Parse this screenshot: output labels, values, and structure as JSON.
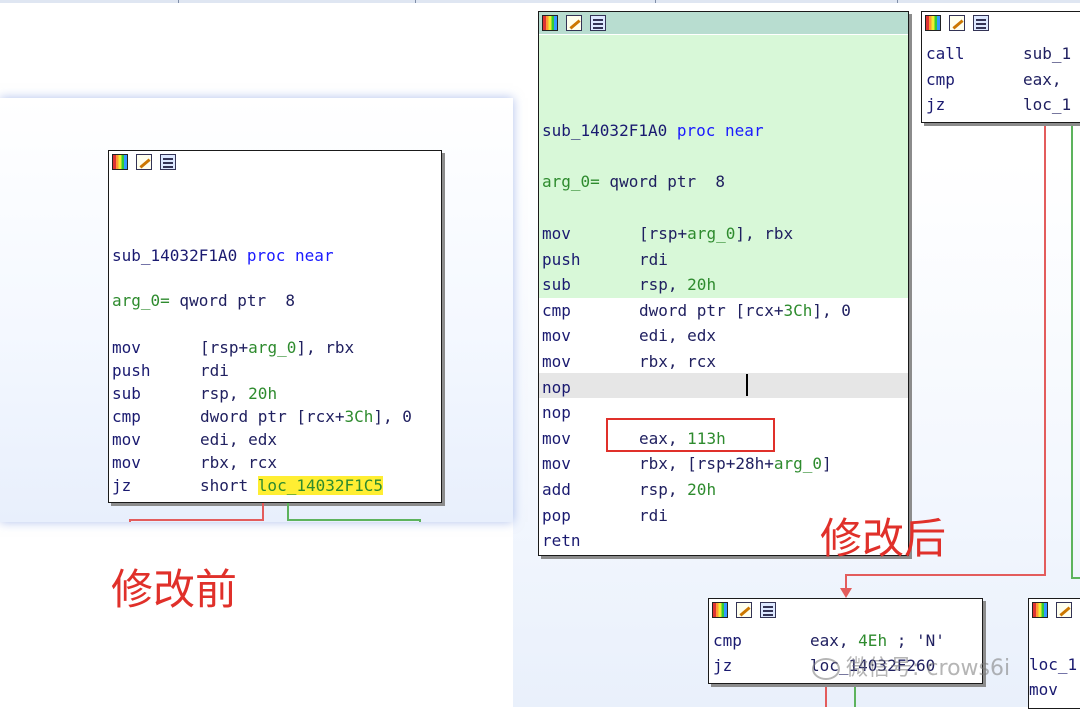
{
  "left_node": {
    "proc": "sub_14032F1A0",
    "proc_suffix": "proc near",
    "arg": "arg_0=",
    "arg_rest": " qword ptr  8",
    "rows": [
      {
        "m": "mov",
        "a": "[rsp+",
        "b": "arg_0",
        "c": "], rbx"
      },
      {
        "m": "push",
        "a": "rdi",
        "b": "",
        "c": ""
      },
      {
        "m": "sub",
        "a": "rsp, ",
        "b": "20h",
        "c": ""
      },
      {
        "m": "cmp",
        "a": "dword ptr [rcx+",
        "b": "3Ch",
        "c": "], 0"
      },
      {
        "m": "mov",
        "a": "edi, edx",
        "b": "",
        "c": ""
      },
      {
        "m": "mov",
        "a": "rbx, rcx",
        "b": "",
        "c": ""
      },
      {
        "m": "jz",
        "a": "short ",
        "b": "loc_14032F1C5",
        "c": ""
      }
    ],
    "caption": "修改前"
  },
  "main_node": {
    "proc": "sub_14032F1A0",
    "proc_suffix": "proc near",
    "arg": "arg_0=",
    "arg_rest": " qword ptr  8",
    "rows": [
      {
        "m": "mov",
        "a": "[rsp+",
        "b": "arg_0",
        "c": "], rbx"
      },
      {
        "m": "push",
        "a": "rdi",
        "b": "",
        "c": ""
      },
      {
        "m": "sub",
        "a": "rsp, ",
        "b": "20h",
        "c": ""
      },
      {
        "m": "cmp",
        "a": "dword ptr [rcx+",
        "b": "3Ch",
        "c": "], 0"
      },
      {
        "m": "mov",
        "a": "edi, edx",
        "b": "",
        "c": ""
      },
      {
        "m": "mov",
        "a": "rbx, rcx",
        "b": "",
        "c": ""
      },
      {
        "m": "nop",
        "a": "",
        "b": "",
        "c": ""
      },
      {
        "m": "nop",
        "a": "",
        "b": "",
        "c": ""
      },
      {
        "m": "mov",
        "a": "eax, ",
        "b": "113h",
        "c": ""
      },
      {
        "m": "mov",
        "a": "rbx, [rsp+28h+",
        "b": "arg_0",
        "c": "]"
      },
      {
        "m": "add",
        "a": "rsp, ",
        "b": "20h",
        "c": ""
      },
      {
        "m": "pop",
        "a": "rdi",
        "b": "",
        "c": ""
      },
      {
        "m": "retn",
        "a": "",
        "b": "",
        "c": ""
      }
    ],
    "caption": "修改后"
  },
  "top_right_node": {
    "rows": [
      {
        "m": "call",
        "a": "sub_1"
      },
      {
        "m": "cmp",
        "a": "eax,"
      },
      {
        "m": "jz",
        "a": "loc_1"
      }
    ]
  },
  "bottom_node": {
    "rows": [
      {
        "m": "cmp",
        "a": "eax, ",
        "b": "4Eh",
        "c": " ; 'N'"
      },
      {
        "m": "jz",
        "a": "loc_14032F260",
        "b": "",
        "c": ""
      }
    ]
  },
  "bottom_right_node": {
    "rows": [
      {
        "m": "loc_1",
        "a": ""
      },
      {
        "m": "mov",
        "a": ""
      }
    ]
  },
  "watermark": "微信号: crows6i",
  "colors": {
    "accent_red": "#e0302a",
    "node_header_green": "#b8ddd0",
    "highlight_yellow": "#ffee33",
    "block_green": "#d8f8d8"
  }
}
